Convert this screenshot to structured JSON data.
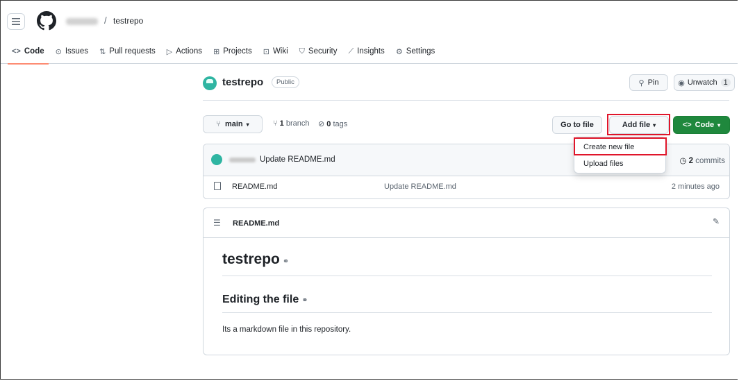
{
  "header": {
    "repo_crumb": "testrepo",
    "crumb_separator": "/",
    "tabs": [
      {
        "label": "Code",
        "icon": "code-icon",
        "glyph": "<>"
      },
      {
        "label": "Issues",
        "icon": "issue-icon",
        "glyph": "⊙"
      },
      {
        "label": "Pull requests",
        "icon": "pull-request-icon",
        "glyph": "⇅"
      },
      {
        "label": "Actions",
        "icon": "play-icon",
        "glyph": "▷"
      },
      {
        "label": "Projects",
        "icon": "table-icon",
        "glyph": "⊞"
      },
      {
        "label": "Wiki",
        "icon": "book-icon",
        "glyph": "⊡"
      },
      {
        "label": "Security",
        "icon": "shield-icon",
        "glyph": "⛉"
      },
      {
        "label": "Insights",
        "icon": "graph-icon",
        "glyph": "⟋"
      },
      {
        "label": "Settings",
        "icon": "gear-icon",
        "glyph": "⚙"
      }
    ],
    "selected_tab": "Code"
  },
  "repo": {
    "name": "testrepo",
    "visibility": "Public",
    "pin_label": "Pin",
    "unwatch_label": "Unwatch",
    "watch_count": "1"
  },
  "branch_bar": {
    "branch": "main",
    "branch_count": "1",
    "branch_word": "branch",
    "tag_count": "0",
    "tag_word": "tags",
    "goto_file": "Go to file",
    "add_file": "Add file",
    "code": "Code"
  },
  "dropdown": {
    "items": [
      "Create new file",
      "Upload files"
    ]
  },
  "latest_commit": {
    "message": "Update README.md",
    "commits_count": "2",
    "commits_word": "commits"
  },
  "files": [
    {
      "name": "README.md",
      "commit": "Update README.md",
      "time": "2 minutes ago"
    }
  ],
  "readme": {
    "filename": "README.md",
    "h1": "testrepo",
    "h2": "Editing the file",
    "paragraph": "Its a markdown file in this repository."
  },
  "colors": {
    "accent_tab": "#fd8c73",
    "primary_button": "#1f883d",
    "highlight": "#e0152a"
  }
}
